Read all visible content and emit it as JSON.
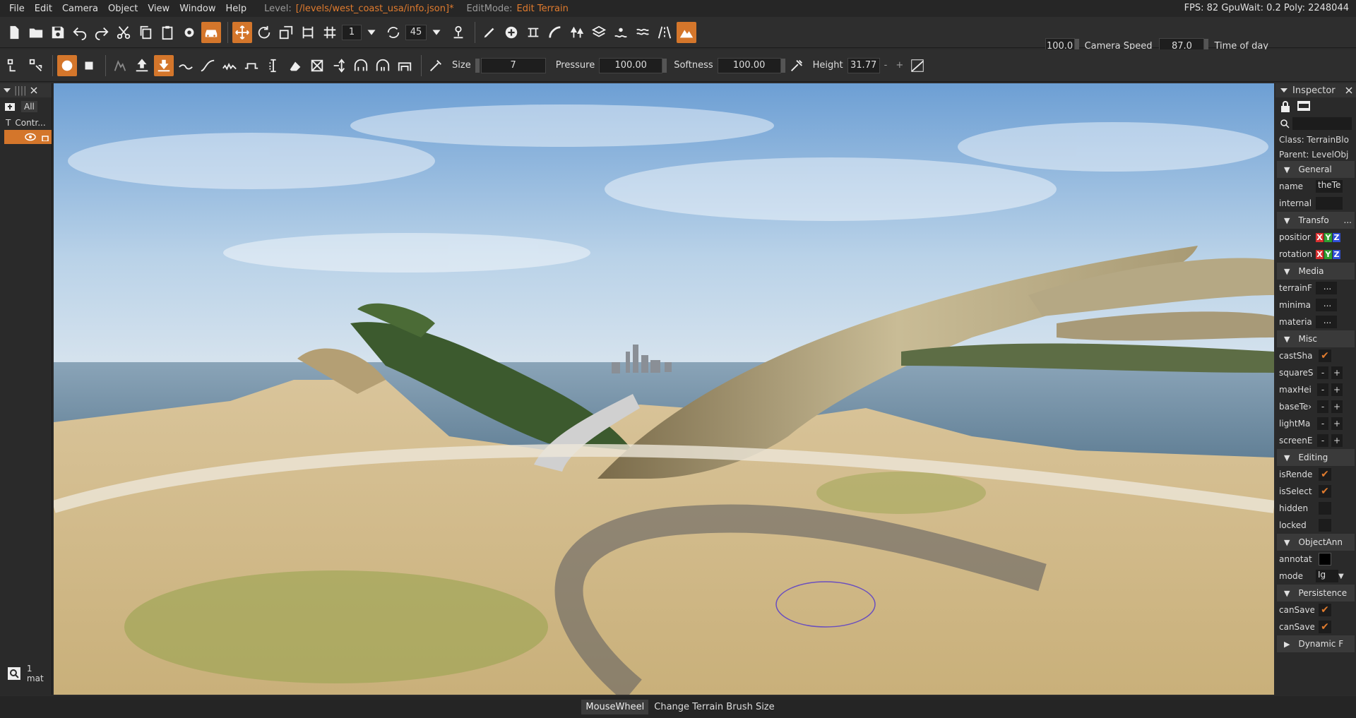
{
  "menu": {
    "items": [
      "File",
      "Edit",
      "Camera",
      "Object",
      "View",
      "Window",
      "Help"
    ],
    "level_label": "Level:",
    "level_value": "[/levels/west_coast_usa/info.json]*",
    "editmode_label": "EditMode:",
    "editmode_value": "Edit Terrain",
    "stats": "FPS: 82  GpuWait: 0.2  Poly: 2248044"
  },
  "toolbar1": {
    "snap_value": "1",
    "rotate_snap_value": "45",
    "camera_speed_value": "100.0",
    "camera_speed_label": "Camera Speed",
    "time_of_day_value": "87.0",
    "time_of_day_label": "Time of day"
  },
  "toolbar2": {
    "size_label": "Size",
    "size_value": "7",
    "pressure_label": "Pressure",
    "pressure_value": "100.00",
    "softness_label": "Softness",
    "softness_value": "100.00",
    "height_label": "Height",
    "height_value": "31.77",
    "minus": "-",
    "plus": "+"
  },
  "left_panel": {
    "filter_all": "All",
    "row_type": "T",
    "row_label": "Contr...",
    "footer_count": "1 mat"
  },
  "inspector": {
    "title": "Inspector",
    "class_line": "Class:  TerrainBlo",
    "parent_line": "Parent:  LevelObj",
    "sections": {
      "general": "General",
      "transform": "Transfo",
      "media": "Media",
      "misc": "Misc",
      "editing": "Editing",
      "objectann": "ObjectAnn",
      "persistence": "Persistence",
      "dynamic": "Dynamic F"
    },
    "fields": {
      "name_label": "name",
      "name_value": "theTe",
      "internal_label": "internal",
      "position_label": "positior",
      "rotation_label": "rotation",
      "terrain_label": "terrainF",
      "minimap_label": "minima",
      "material_label": "materia",
      "dots": "...",
      "castshadows_label": "castSha",
      "squaresize_label": "squareS",
      "maxheight_label": "maxHei",
      "basetex_label": "baseTe›",
      "lightmap_label": "lightMa",
      "screenerr_label": "screenE",
      "isrender_label": "isRende",
      "isselect_label": "isSelect",
      "hidden_label": "hidden",
      "locked_label": "locked",
      "annotation_label": "annotat",
      "mode_label": "mode",
      "mode_value": "Ig",
      "cansave1_label": "canSave",
      "cansave2_label": "canSave",
      "transform_dots": "..."
    }
  },
  "status": {
    "key": "MouseWheel",
    "action": "Change Terrain Brush Size"
  },
  "colors": {
    "accent": "#d4762b",
    "axis_x": "#d83030",
    "axis_y": "#30a030",
    "axis_z": "#3050d8"
  }
}
